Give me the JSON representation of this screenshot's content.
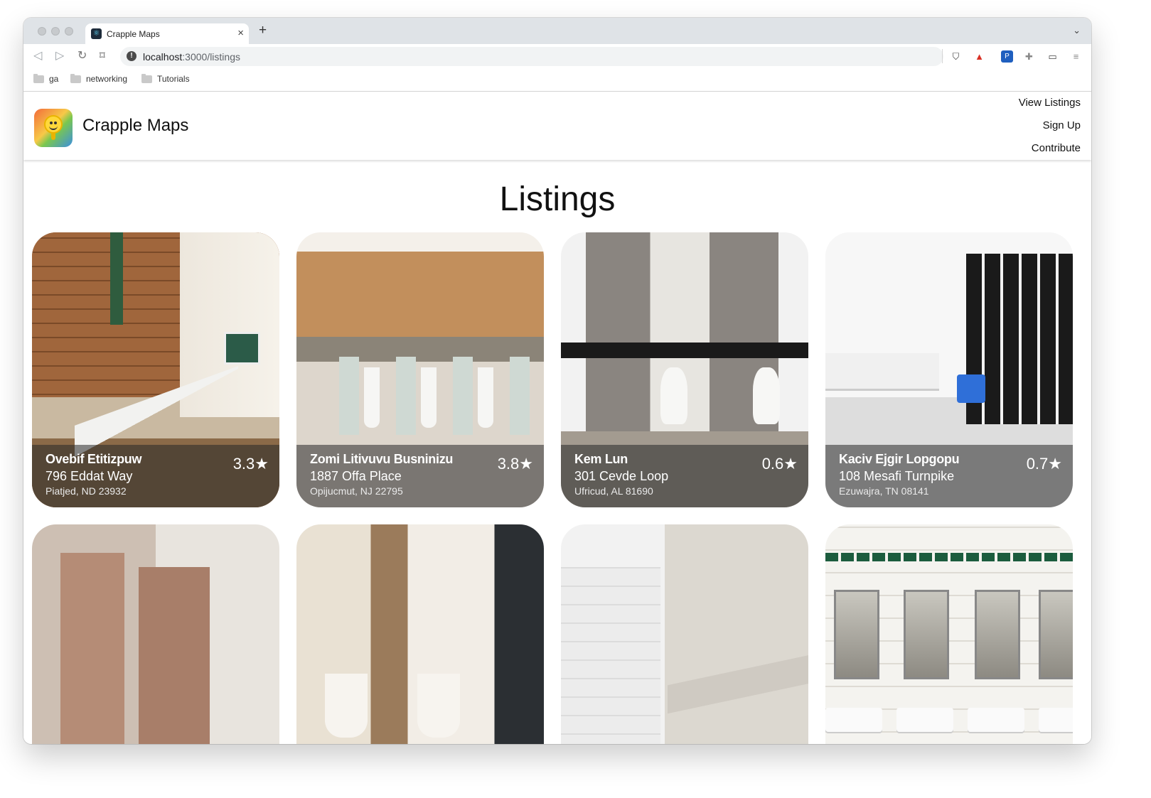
{
  "browser": {
    "tab_title": "Crapple Maps",
    "tab_close": "×",
    "new_tab": "+",
    "url_host": "localhost",
    "url_path": ":3000/listings",
    "bookmarks": [
      "ga",
      "networking",
      "Tutorials"
    ]
  },
  "app": {
    "brand": "Crapple Maps",
    "nav": [
      "View Listings",
      "Sign Up",
      "Contribute"
    ]
  },
  "page": {
    "title": "Listings"
  },
  "listings": [
    {
      "name": "Ovebif Etitizpuw",
      "street": "796 Eddat Way",
      "city": "Piatjed, ND 23932",
      "rating": "3.3★"
    },
    {
      "name": "Zomi Litivuvu Busninizu",
      "street": "1887 Offa Place",
      "city": "Opijucmut, NJ 22795",
      "rating": "3.8★"
    },
    {
      "name": "Kem Lun",
      "street": "301 Cevde Loop",
      "city": "Ufricud, AL 81690",
      "rating": "0.6★"
    },
    {
      "name": "Kaciv Ejgir Lopgopu",
      "street": "108 Mesafi Turnpike",
      "city": "Ezuwajra, TN 08141",
      "rating": "0.7★"
    }
  ],
  "colors": {
    "chrome_tabstrip": "#dfe3e7",
    "card_overlay": "rgba(40,40,40,0.55)"
  }
}
